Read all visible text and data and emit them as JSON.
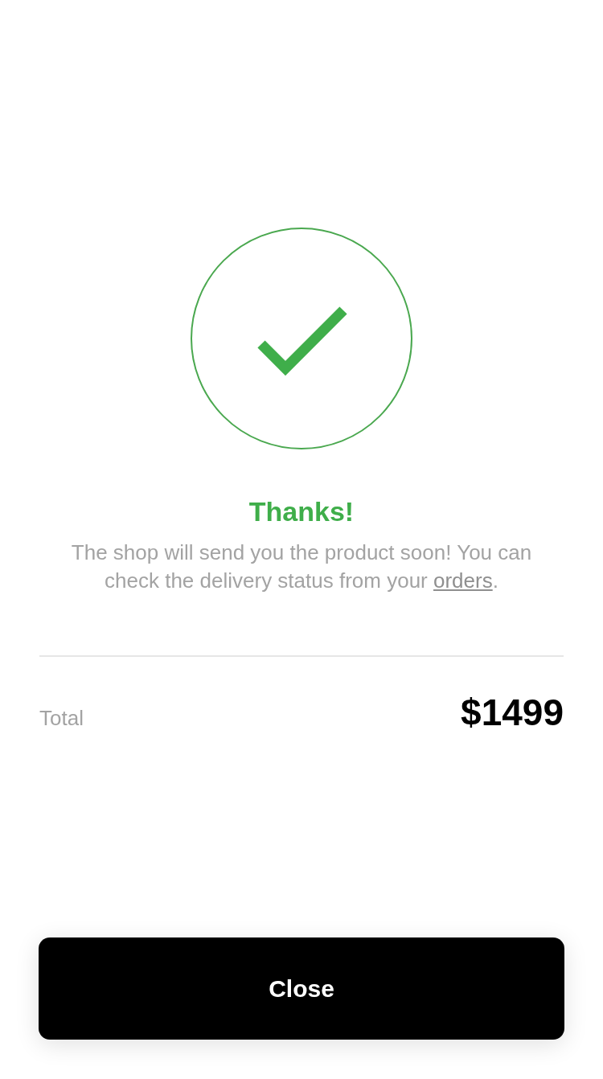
{
  "title": "Thanks!",
  "message": {
    "text": "The shop will send you the product soon! You can check the delivery status from your ",
    "link": "orders",
    "after": "."
  },
  "total": {
    "label": "Total",
    "amount": "$1499"
  },
  "buttons": [
    {
      "label": "Close",
      "kind": "primary"
    }
  ]
}
